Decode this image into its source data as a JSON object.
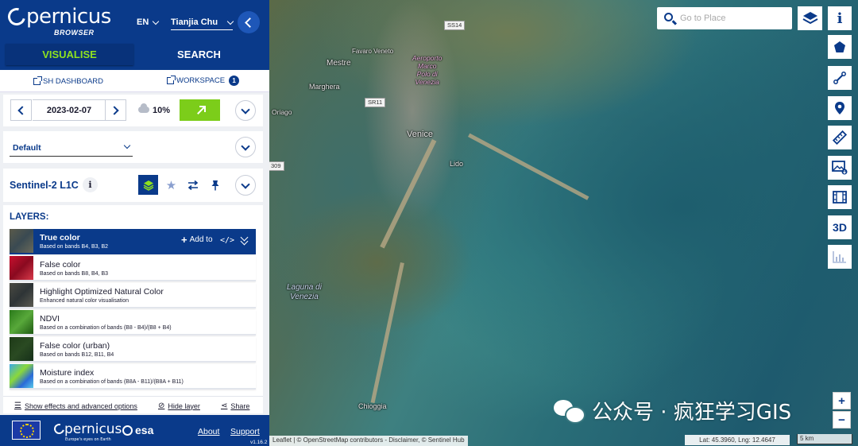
{
  "header": {
    "logo_text": "pernicus",
    "logo_sub": "BROWSER",
    "language": "EN",
    "user_name": "Tianjia Chu"
  },
  "tabs": [
    {
      "label": "VISUALISE",
      "active": true
    },
    {
      "label": "SEARCH",
      "active": false
    }
  ],
  "links": {
    "dashboard": "SH DASHBOARD",
    "workspace": "WORKSPACE",
    "workspace_count": "1"
  },
  "date_panel": {
    "date": "2023-02-07",
    "cloud_coverage": "10%"
  },
  "style_panel": {
    "selected": "Default"
  },
  "collection": {
    "name": "Sentinel-2 L1C",
    "info": "i"
  },
  "layers": {
    "title": "LAYERS:",
    "add_to_label": "Add to",
    "items": [
      {
        "name": "True color",
        "desc": "Based on bands B4, B3, B2",
        "selected": true
      },
      {
        "name": "False color",
        "desc": "Based on bands B8, B4, B3",
        "selected": false
      },
      {
        "name": "Highlight Optimized Natural Color",
        "desc": "Enhanced natural color visualisation",
        "selected": false
      },
      {
        "name": "NDVI",
        "desc": "Based on a combination of bands (B8 - B4)/(B8 + B4)",
        "selected": false
      },
      {
        "name": "False color (urban)",
        "desc": "Based on bands B12, B11, B4",
        "selected": false
      },
      {
        "name": "Moisture index",
        "desc": "Based on a combination of bands (B8A - B11)/(B8A + B11)",
        "selected": false
      }
    ]
  },
  "options": {
    "effects": "Show effects and advanced options",
    "hide": "Hide layer",
    "share": "Share"
  },
  "footer": {
    "esa": "esa",
    "copernicus": "pernicus",
    "copernicus_tag": "Europe's eyes on Earth",
    "about": "About",
    "support": "Support",
    "version": "v1.16.2"
  },
  "map": {
    "search_placeholder": "Go to Place",
    "labels": {
      "mestre": "Mestre",
      "favaro": "Favaro Veneto",
      "marghera": "Marghera",
      "airport": "Aeroporto\nMarco\nPolo di\nVenezia",
      "venice": "Venice",
      "lido": "Lido",
      "oriago": "Oriago",
      "laguna": "Laguna di\nVenezia",
      "chioggia": "Chioggia"
    },
    "roads": {
      "ss14": "SS14",
      "sr11": "SR11",
      "s09": "309"
    },
    "tools": {
      "info": "i",
      "three_d": "3D"
    },
    "zoom_in": "+",
    "zoom_out": "−",
    "attribution": "Leaflet | © OpenStreetMap contributors - Disclaimer, © Sentinel Hub",
    "coords": "Lat: 45.3960, Lng: 12.4647",
    "scale": "5 km"
  },
  "watermark": "公众号 · 疯狂学习GIS",
  "colors": {
    "brand_blue": "#0a3a8a",
    "accent_green": "#8ee21f",
    "go_green": "#7ccd1a"
  }
}
